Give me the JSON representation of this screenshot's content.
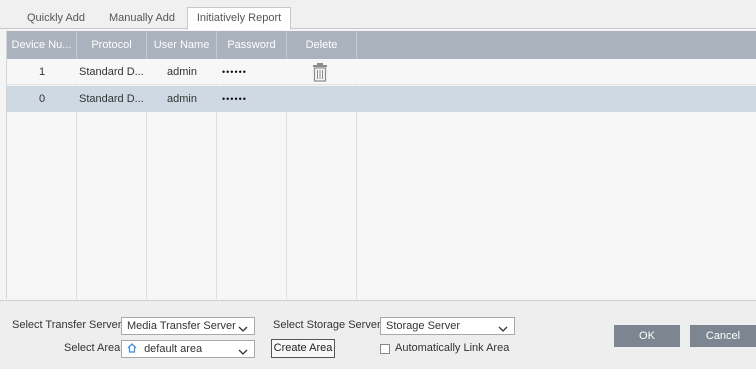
{
  "tabs": [
    {
      "label": "Quickly Add",
      "active": false
    },
    {
      "label": "Manually Add",
      "active": false
    },
    {
      "label": "Initiatively Report",
      "active": true
    }
  ],
  "table": {
    "columns": [
      "Device Nu...",
      "Protocol",
      "User Name",
      "Password",
      "Delete"
    ],
    "rows": [
      {
        "device_number": "1",
        "protocol": "Standard D...",
        "user_name": "admin",
        "password": "••••••",
        "delete_icon": "trash-icon",
        "selected": false
      },
      {
        "device_number": "0",
        "protocol": "Standard D...",
        "user_name": "admin",
        "password": "••••••",
        "delete_icon": null,
        "selected": true
      }
    ]
  },
  "bottom": {
    "transfer_server_label": "Select Transfer Server",
    "transfer_server_value": "Media Transfer Server",
    "storage_server_label": "Select Storage Server",
    "storage_server_value": "Storage Server",
    "area_label": "Select Area",
    "area_value": "default area",
    "create_area_label": "Create Area",
    "auto_link_label": "Automatically Link Area",
    "auto_link_checked": false,
    "ok_label": "OK",
    "cancel_label": "Cancel"
  },
  "colors": {
    "header_bg": "#a9b2bd",
    "selected_row_bg": "#cfd9e3",
    "button_bg": "#7d8590",
    "area_icon": "#3a8ee6"
  }
}
